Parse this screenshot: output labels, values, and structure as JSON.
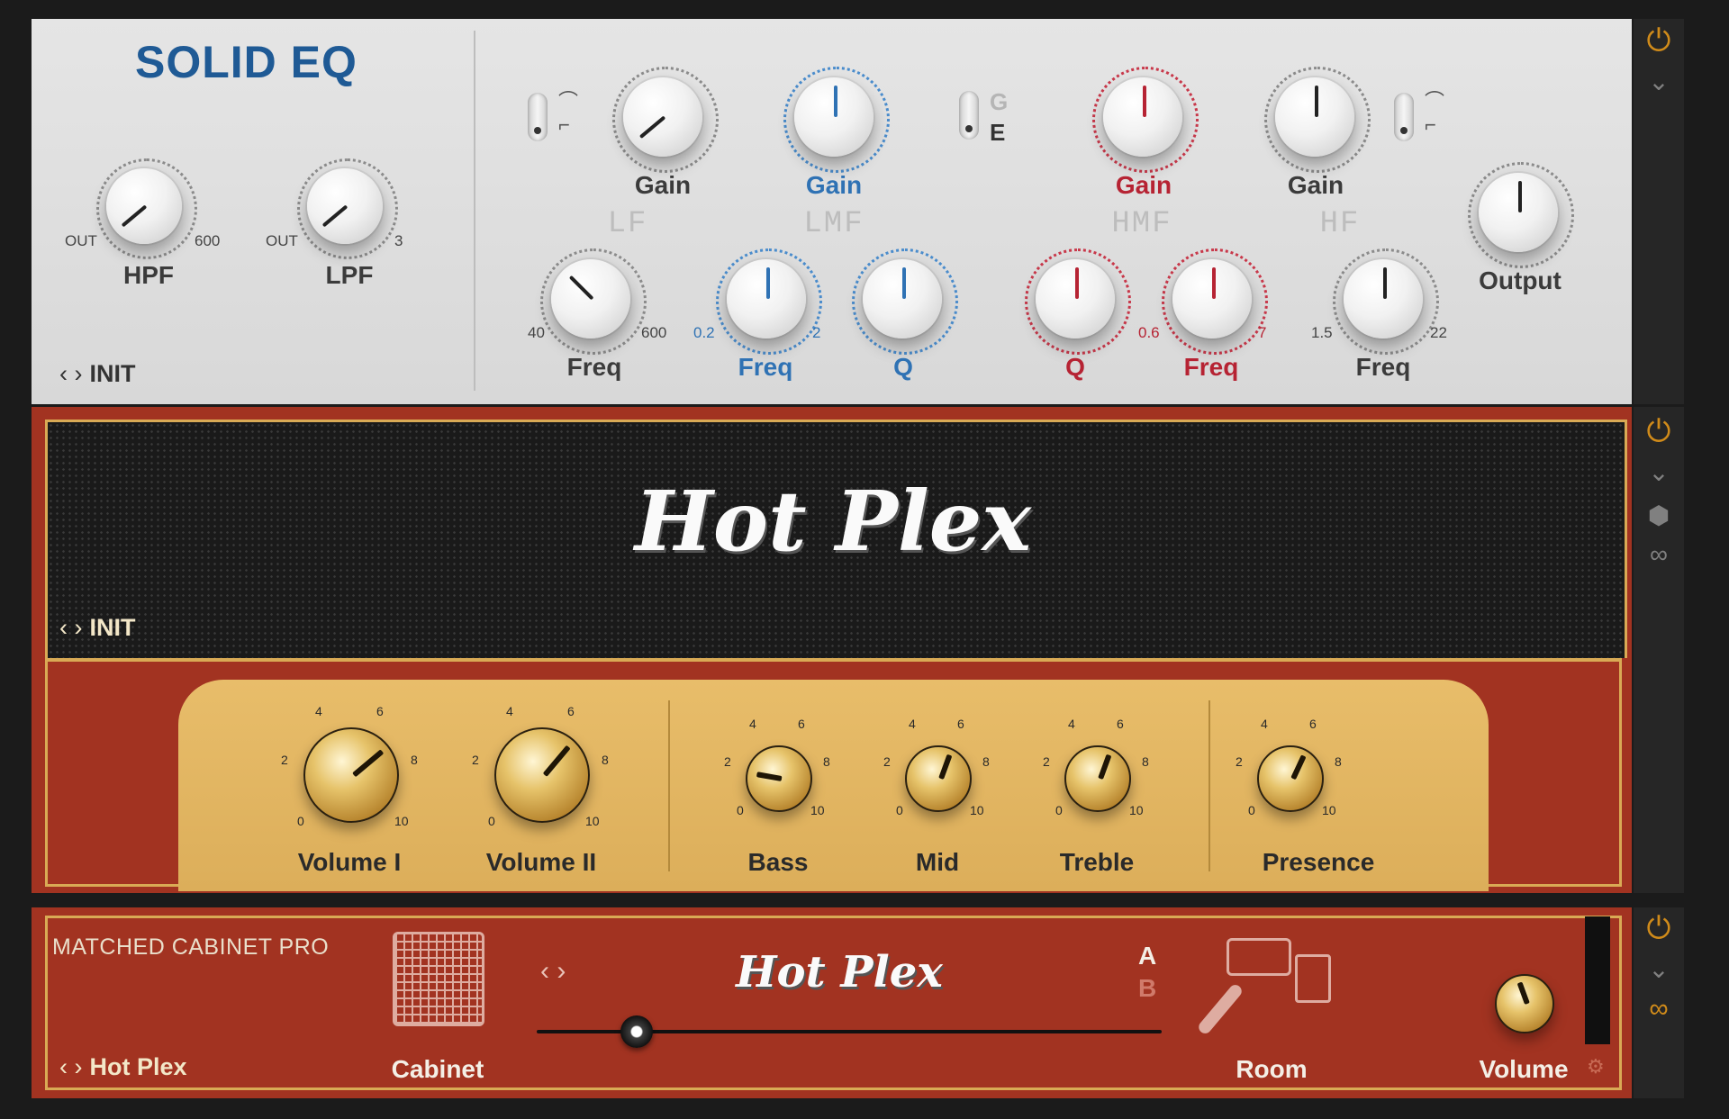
{
  "solid_eq": {
    "title": "SOLID EQ",
    "preset": "INIT",
    "hpf": {
      "label": "HPF",
      "min": "OUT",
      "max": "600"
    },
    "lpf": {
      "label": "LPF",
      "min": "OUT",
      "max": "3"
    },
    "bands": {
      "lf": "LF",
      "lmf": "LMF",
      "hmf": "HMF",
      "hf": "HF"
    },
    "lf": {
      "gain": "Gain",
      "freq": "Freq",
      "freq_min": "40",
      "freq_max": "600"
    },
    "lmf": {
      "gain": "Gain",
      "freq": "Freq",
      "q": "Q",
      "freq_min": "0.2",
      "freq_max": "2"
    },
    "hmf": {
      "gain": "Gain",
      "freq": "Freq",
      "q": "Q",
      "freq_min": "0.6",
      "freq_max": "7"
    },
    "hf": {
      "gain": "Gain",
      "freq": "Freq",
      "freq_min": "1.5",
      "freq_max": "22"
    },
    "ge_switch": {
      "g": "G",
      "e": "E"
    },
    "output": "Output",
    "colors": {
      "title": "#1f5a95",
      "lmf": "#2f72b4",
      "hmf": "#b62333"
    }
  },
  "amp": {
    "logo": "Hot Plex",
    "preset": "INIT",
    "knobs": {
      "volume1": "Volume I",
      "volume2": "Volume II",
      "bass": "Bass",
      "mid": "Mid",
      "treble": "Treble",
      "presence": "Presence"
    },
    "scale": {
      "t0": "0",
      "t2": "2",
      "t4": "4",
      "t6": "6",
      "t8": "8",
      "t10": "10"
    },
    "colors": {
      "body": "#a23321",
      "faceplate": "#e3b563",
      "trim": "#d9aa55"
    }
  },
  "cabinet": {
    "title": "MATCHED CABINET PRO",
    "preset": "Hot Plex",
    "model_logo": "Hot Plex",
    "cabinet_label": "Cabinet",
    "room_label": "Room",
    "volume_label": "Volume",
    "a": "A",
    "b": "B",
    "mic_position": 0.16
  },
  "icons": {
    "power": "power-icon",
    "collapse": "collapse-icon",
    "preset": "preset-icon",
    "stereo": "stereo-link-icon",
    "settings": "gear-icon",
    "nav": "chevron-left-right-icon"
  }
}
